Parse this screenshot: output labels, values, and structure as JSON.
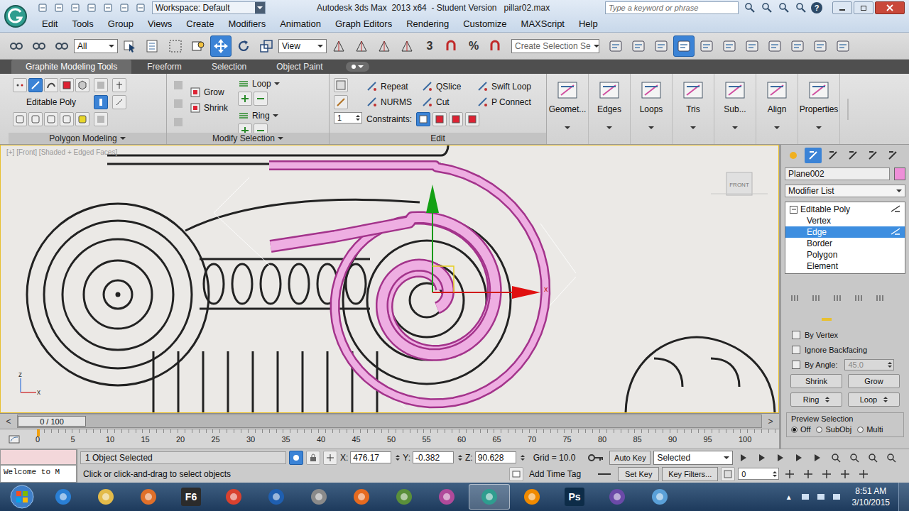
{
  "titlebar": {
    "workspace": "Workspace: Default",
    "title": "Autodesk 3ds Max  2013 x64  - Student Version   pillar02.max",
    "search_placeholder": "Type a keyword or phrase",
    "help": "?"
  },
  "menu": [
    "Edit",
    "Tools",
    "Group",
    "Views",
    "Create",
    "Modifiers",
    "Animation",
    "Graph Editors",
    "Rendering",
    "Customize",
    "MAXScript",
    "Help"
  ],
  "toolbar": {
    "filter": "All",
    "coordinate_system": "View",
    "snaps": [
      "3",
      "%"
    ],
    "named_selection": "Create Selection Se",
    "tools": [
      {
        "kind": "select",
        "selected": false
      },
      {
        "kind": "select-by-name",
        "selected": false
      },
      {
        "kind": "region",
        "selected": false
      },
      {
        "kind": "crossing",
        "selected": false
      },
      {
        "kind": "move",
        "selected": true
      },
      {
        "kind": "rotate",
        "selected": false
      },
      {
        "kind": "scale",
        "selected": false
      }
    ]
  },
  "ribbon_tabs": [
    {
      "label": "Graphite Modeling Tools",
      "selected": true
    },
    {
      "label": "Freeform",
      "selected": false
    },
    {
      "label": "Selection",
      "selected": false
    },
    {
      "label": "Object Paint",
      "selected": false
    }
  ],
  "ribbon": {
    "polygon_modeling": {
      "title": "Polygon Modeling",
      "object": "Editable Poly",
      "subobjects": [
        {
          "kind": "vertex",
          "selected": false
        },
        {
          "kind": "edge",
          "selected": true
        },
        {
          "kind": "border",
          "selected": false
        },
        {
          "kind": "polygon",
          "selected": false
        },
        {
          "kind": "element",
          "selected": false
        }
      ]
    },
    "modify_selection": {
      "title": "Modify Selection",
      "buttons": [
        "Grow",
        "Shrink"
      ],
      "dropdowns": [
        "Loop",
        "Ring"
      ]
    },
    "edit": {
      "title": "Edit",
      "buttons": [
        "Repeat",
        "QSlice",
        "Swift Loop",
        "NURMS",
        "Cut",
        "P Connect"
      ],
      "constraints": "Constraints:",
      "spinner": "1"
    },
    "big_buttons": [
      "Geomet...",
      "Edges",
      "Loops",
      "Tris",
      "Sub...",
      "Align",
      "Properties"
    ]
  },
  "viewport": {
    "label": "[+] [Front] [Shaded + Edged Faces]",
    "viewcube": "FRONT",
    "gizmo_axis": "x",
    "tripod": [
      "z",
      "x"
    ]
  },
  "command_panel": {
    "object_name": "Plane002",
    "object_color": "#ee8fd8",
    "modifier_list": "Modifier List",
    "stack": [
      {
        "label": "Editable Poly",
        "kind": "modifier",
        "selected": false
      },
      {
        "label": "Vertex",
        "kind": "subobject",
        "selected": false
      },
      {
        "label": "Edge",
        "kind": "subobject",
        "selected": true
      },
      {
        "label": "Border",
        "kind": "subobject",
        "selected": false
      },
      {
        "label": "Polygon",
        "kind": "subobject",
        "selected": false
      },
      {
        "label": "Element",
        "kind": "subobject",
        "selected": false
      }
    ],
    "selection": {
      "options": [
        {
          "label": "By Vertex",
          "checked": false
        },
        {
          "label": "Ignore Backfacing",
          "checked": false
        },
        {
          "label": "By Angle:",
          "checked": false
        }
      ],
      "angle": "45.0",
      "angle_disabled": true,
      "buttons": [
        "Shrink",
        "Grow"
      ],
      "spin_buttons": [
        "Ring",
        "Loop"
      ],
      "preview": {
        "title": "Preview Selection",
        "options": [
          {
            "label": "Off",
            "selected": true
          },
          {
            "label": "SubObj",
            "selected": false
          },
          {
            "label": "Multi",
            "selected": false
          }
        ]
      }
    }
  },
  "timeline": {
    "position": "0 / 100",
    "level": 0,
    "prev": "<",
    "next": ">",
    "ticks": [
      "0",
      "5",
      "10",
      "15",
      "20",
      "25",
      "30",
      "35",
      "40",
      "45",
      "50",
      "55",
      "60",
      "65",
      "70",
      "75",
      "80",
      "85",
      "90",
      "95",
      "100"
    ]
  },
  "status": {
    "listener": "Welcome to M",
    "selection": "1 Object Selected",
    "coords": [
      {
        "axis": "X:",
        "value": "476.17"
      },
      {
        "axis": "Y:",
        "value": "-0.382"
      },
      {
        "axis": "Z:",
        "value": "90.628"
      }
    ],
    "grid": "Grid = 10.0",
    "prompt": "Click or click-and-drag to select objects",
    "time_tag": "Add Time Tag",
    "auto_key": "Auto Key",
    "set_key": "Set Key",
    "key_mode": "Selected",
    "key_filters": "Key Filters...",
    "frame": "0"
  },
  "taskbar": {
    "apps": [
      {
        "kind": "ie",
        "label": "",
        "active": false
      },
      {
        "kind": "explorer",
        "label": "",
        "active": false
      },
      {
        "kind": "media",
        "label": "",
        "active": false
      },
      {
        "kind": "f6",
        "label": "F6",
        "active": false
      },
      {
        "kind": "chrome",
        "label": "",
        "active": false
      },
      {
        "kind": "outlook",
        "label": "",
        "active": false
      },
      {
        "kind": "app",
        "label": "",
        "active": false
      },
      {
        "kind": "firefox",
        "label": "",
        "active": false
      },
      {
        "kind": "app2",
        "label": "",
        "active": false
      },
      {
        "kind": "paint",
        "label": "",
        "active": false
      },
      {
        "kind": "max",
        "label": "",
        "active": true
      },
      {
        "kind": "vlc",
        "label": "",
        "active": false
      },
      {
        "kind": "ps",
        "label": "Ps",
        "active": false
      },
      {
        "kind": "app3",
        "label": "",
        "active": false
      },
      {
        "kind": "notes",
        "label": "",
        "active": false
      }
    ],
    "tray_arrow": "▲",
    "time": "8:51 AM",
    "date": "3/10/2015"
  }
}
